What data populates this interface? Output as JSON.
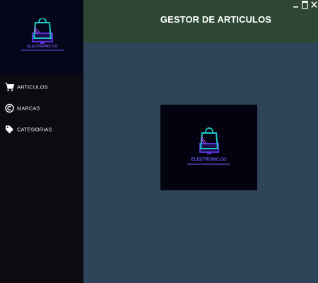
{
  "brand": {
    "name": "ELECTRONIC.CO",
    "accent": "#7b5cf0",
    "bag_color": "#1ec6c7",
    "monitor_color": "#8a3ff0"
  },
  "header": {
    "title": "GESTOR DE ARTICULOS",
    "bg": "#2e4733"
  },
  "window_controls": [
    {
      "name": "minimize-icon"
    },
    {
      "name": "maximize-icon"
    },
    {
      "name": "close-icon"
    }
  ],
  "sidebar": {
    "bg": "#0d0a11",
    "items": [
      {
        "label": "ARTICULOS",
        "icon": "cart-icon"
      },
      {
        "label": "MARCAS",
        "icon": "copyright-icon"
      },
      {
        "label": "CATEGORIAS",
        "icon": "tag-icon"
      }
    ]
  },
  "content": {
    "bg": "#2d4459"
  }
}
